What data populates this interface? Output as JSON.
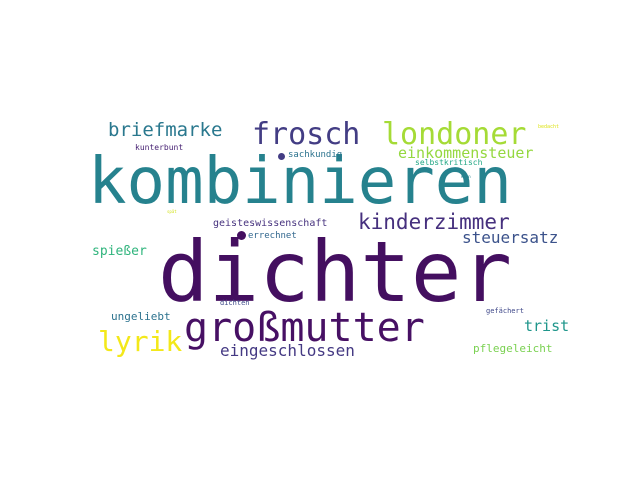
{
  "words": [
    {
      "text": "kombinieren",
      "color": "#26828e"
    },
    {
      "text": "dichter",
      "color": "#440f60"
    },
    {
      "text": "großmutter",
      "color": "#471064"
    },
    {
      "text": "frosch",
      "color": "#433d84"
    },
    {
      "text": "londoner",
      "color": "#a5db36"
    },
    {
      "text": "briefmarke",
      "color": "#2a788e"
    },
    {
      "text": "lyrik",
      "color": "#f3e81a"
    },
    {
      "text": "kinderzimmer",
      "color": "#46307e"
    },
    {
      "text": "einkommensteuer",
      "color": "#95d840"
    },
    {
      "text": "steuersatz",
      "color": "#3b528b"
    },
    {
      "text": "eingeschlossen",
      "color": "#443983"
    },
    {
      "text": "trist",
      "color": "#1f968b"
    },
    {
      "text": "spießer",
      "color": "#2fb47c"
    },
    {
      "text": "ungeliebt",
      "color": "#2c728e"
    },
    {
      "text": "pflegeleicht",
      "color": "#7ad151"
    },
    {
      "text": "geisteswissenschaft",
      "color": "#46327e"
    },
    {
      "text": "kunterbunt",
      "color": "#482374"
    },
    {
      "text": "sachkundig",
      "color": "#2c738e"
    },
    {
      "text": "selbstkritisch",
      "color": "#22a785"
    },
    {
      "text": "errechnet",
      "color": "#31678e"
    },
    {
      "text": "dichten",
      "color": "#3e4a89"
    },
    {
      "text": "gefächert",
      "color": "#3f4889"
    },
    {
      "text": "bedacht",
      "color": "#dde318"
    },
    {
      "text": "kann",
      "color": "#26818e"
    },
    {
      "text": "spät",
      "color": "#d2e21b"
    }
  ]
}
